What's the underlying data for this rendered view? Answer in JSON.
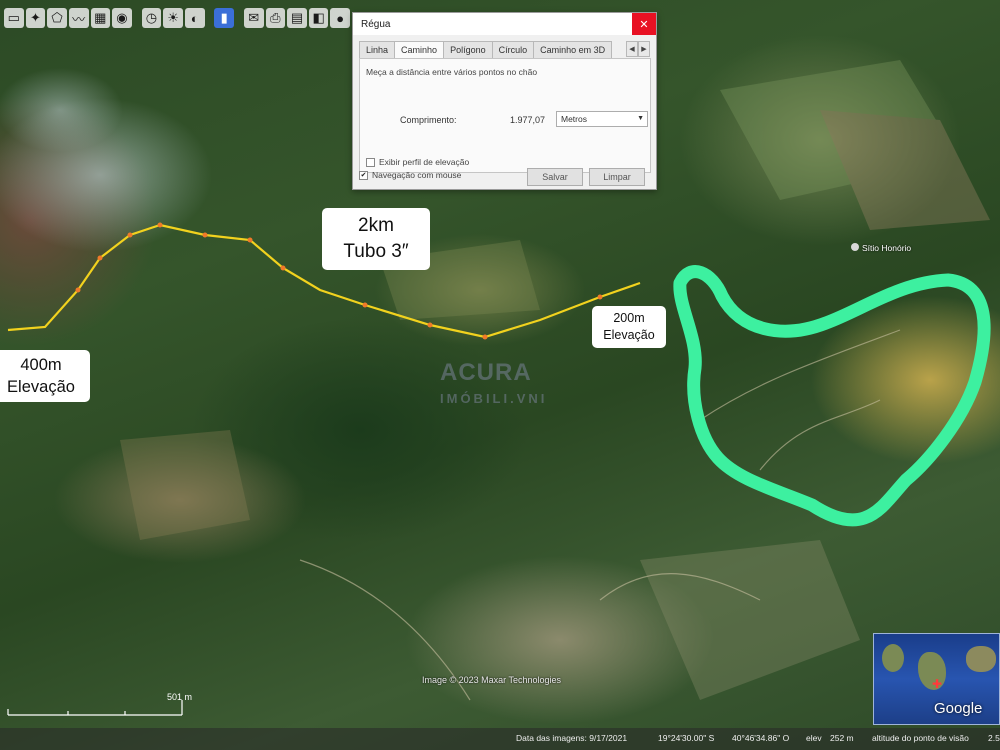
{
  "toolbar": {
    "icons": [
      "hide-sidebar-icon",
      "placemark-icon",
      "polygon-icon",
      "path-icon",
      "image-overlay-icon",
      "record-tour-icon",
      "historical-imagery-icon",
      "sunlight-icon",
      "planets-icon",
      "ruler-icon",
      "email-icon",
      "print-icon",
      "save-image-icon",
      "maps-icon",
      "earth-icon"
    ]
  },
  "ruler": {
    "title": "Régua",
    "close": "✕",
    "tabs": [
      "Linha",
      "Caminho",
      "Polígono",
      "Círculo",
      "Caminho em 3D"
    ],
    "active_tab": "Caminho",
    "description": "Meça a distância entre vários pontos no chão",
    "length_label": "Comprimento:",
    "length_value": "1.977,07",
    "unit": "Metros",
    "elevation_profile_label": "Exibir perfil de elevação",
    "elevation_profile_checked": false,
    "mouse_nav_label": "Navegação com mouse",
    "mouse_nav_checked": true,
    "save_label": "Salvar",
    "clear_label": "Limpar"
  },
  "labels": {
    "route_line1": "2km",
    "route_line2": "Tubo 3″",
    "low_line1": "200m",
    "low_line2": "Elevação",
    "high_line1": "400m",
    "high_line2": "Elevação"
  },
  "map": {
    "watermark_line1": "ACURA",
    "watermark_line2": "IMÓBILI.VNI",
    "place_name": "Sítio Honório",
    "copyright": "Image © 2023 Maxar Technologies",
    "scale": "501 m",
    "path_color": "#f2d21e",
    "area_outline_color": "#3df0a0"
  },
  "status": {
    "imagery_date": "Data das imagens: 9/17/2021",
    "lat": "19°24'30.00\" S",
    "lon": "40°46'34.86\" O",
    "elev_label": "elev",
    "elev_value": "252 m",
    "eye_alt": "altitude do ponto de visão",
    "eye_alt_value": "2.5"
  },
  "overview": {
    "logo": "Google"
  }
}
